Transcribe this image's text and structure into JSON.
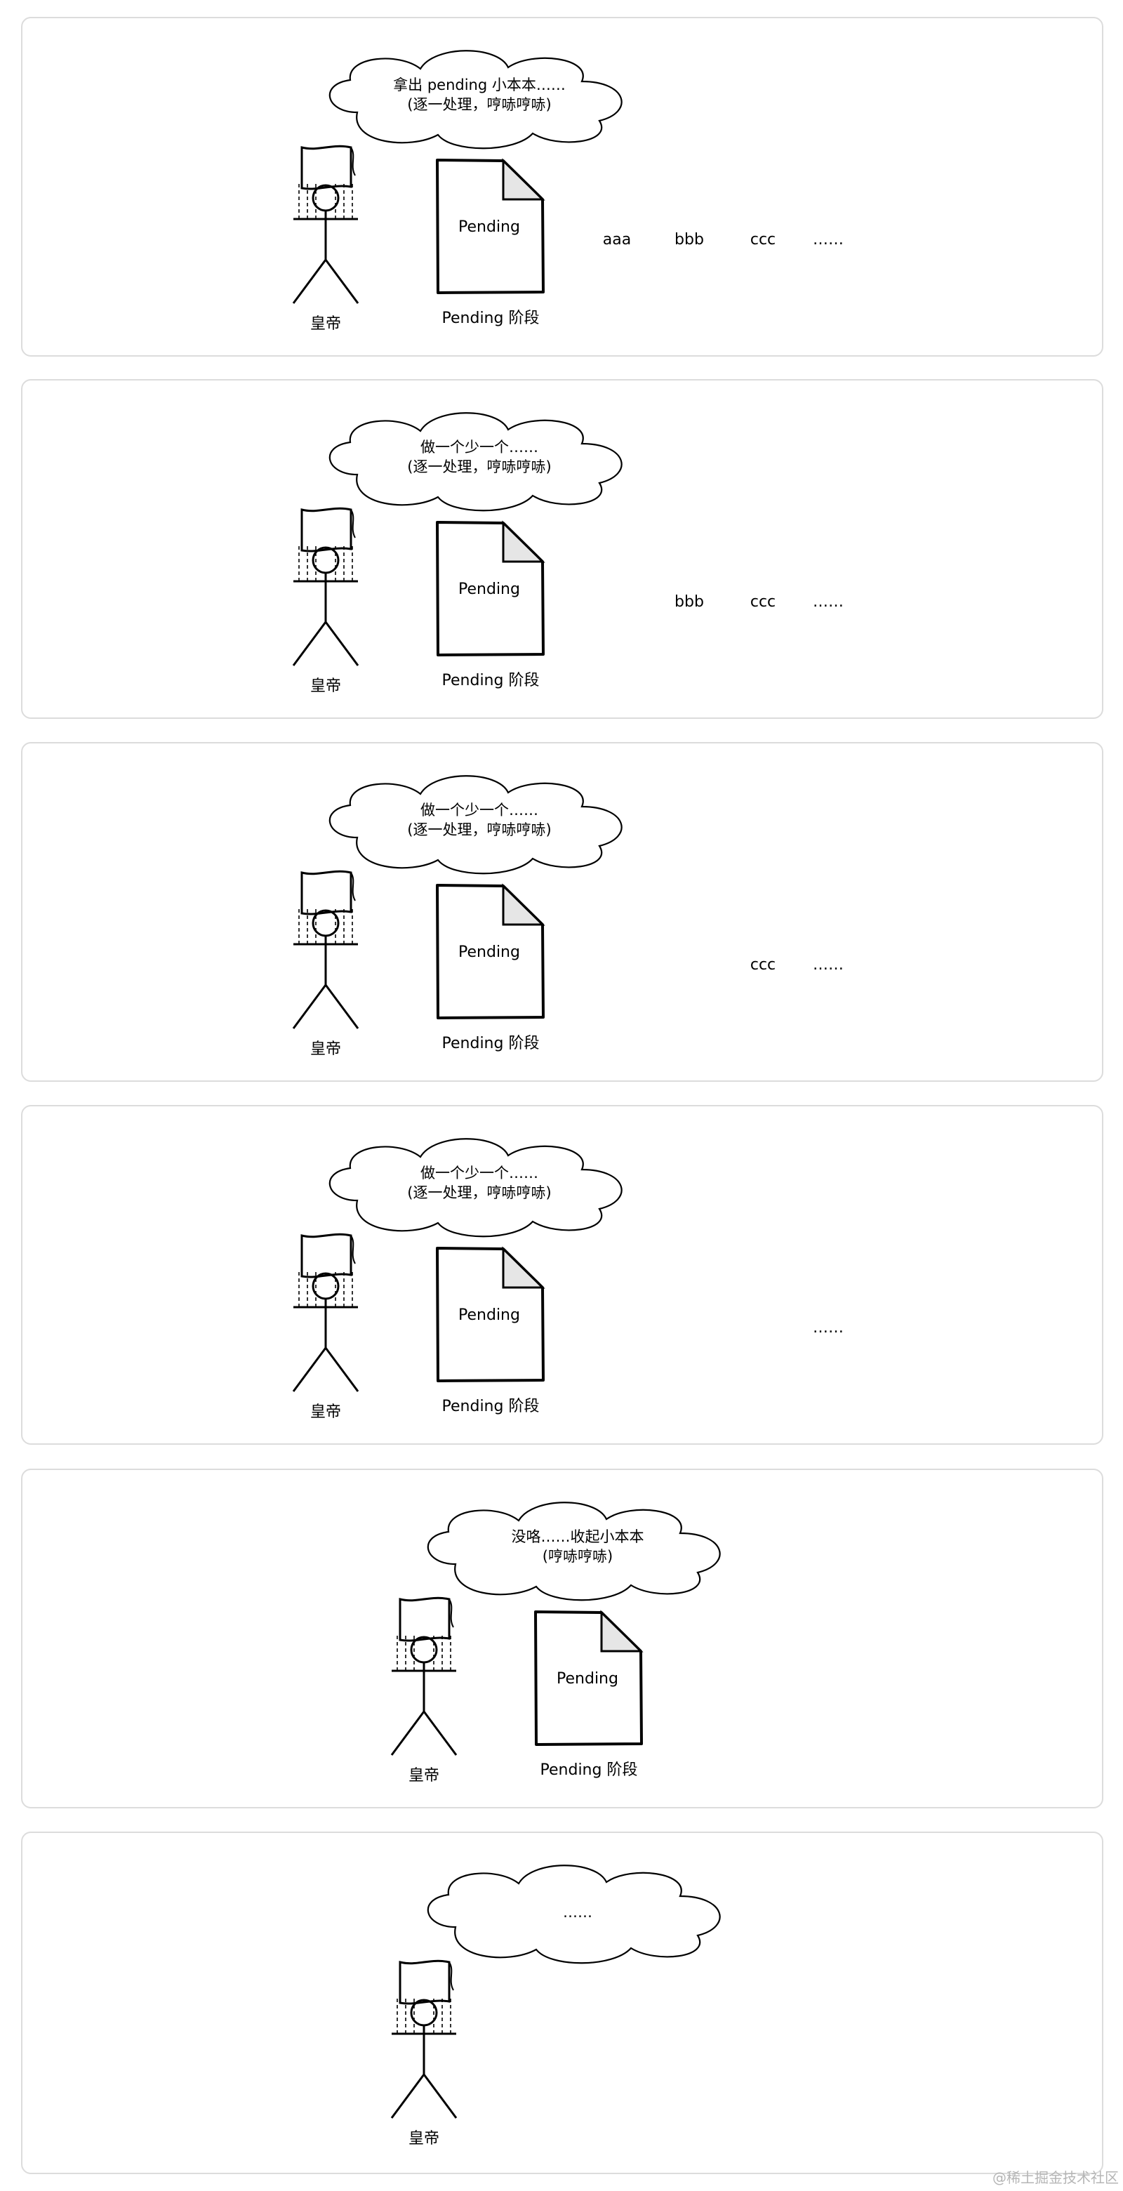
{
  "panels": [
    {
      "cloud": [
        "拿出 pending 小本本……",
        "(逐一处理，哼哧哼哧)"
      ],
      "emperor": "皇帝",
      "doc_label": "Pending",
      "stage": "Pending 阶段",
      "queue": [
        "aaa",
        "bbb",
        "ccc",
        "……"
      ],
      "layout": "left"
    },
    {
      "cloud": [
        "做一个少一个……",
        "(逐一处理，哼哧哼哧)"
      ],
      "emperor": "皇帝",
      "doc_label": "Pending",
      "stage": "Pending 阶段",
      "queue": [
        "",
        "bbb",
        "ccc",
        "……"
      ],
      "layout": "left"
    },
    {
      "cloud": [
        "做一个少一个……",
        "(逐一处理，哼哧哼哧)"
      ],
      "emperor": "皇帝",
      "doc_label": "Pending",
      "stage": "Pending 阶段",
      "queue": [
        "",
        "",
        "ccc",
        "……"
      ],
      "layout": "left"
    },
    {
      "cloud": [
        "做一个少一个……",
        "(逐一处理，哼哧哼哧)"
      ],
      "emperor": "皇帝",
      "doc_label": "Pending",
      "stage": "Pending 阶段",
      "queue": [
        "",
        "",
        "",
        "……"
      ],
      "layout": "left"
    },
    {
      "cloud": [
        "没咯……收起小本本",
        "(哼哧哼哧)"
      ],
      "emperor": "皇帝",
      "doc_label": "Pending",
      "stage": "Pending 阶段",
      "queue": [],
      "layout": "right"
    },
    {
      "cloud": [
        "……"
      ],
      "emperor": "皇帝",
      "doc_label": "",
      "stage": "",
      "queue": [],
      "layout": "right-nodoc"
    }
  ],
  "watermark": "@稀土掘金技术社区"
}
